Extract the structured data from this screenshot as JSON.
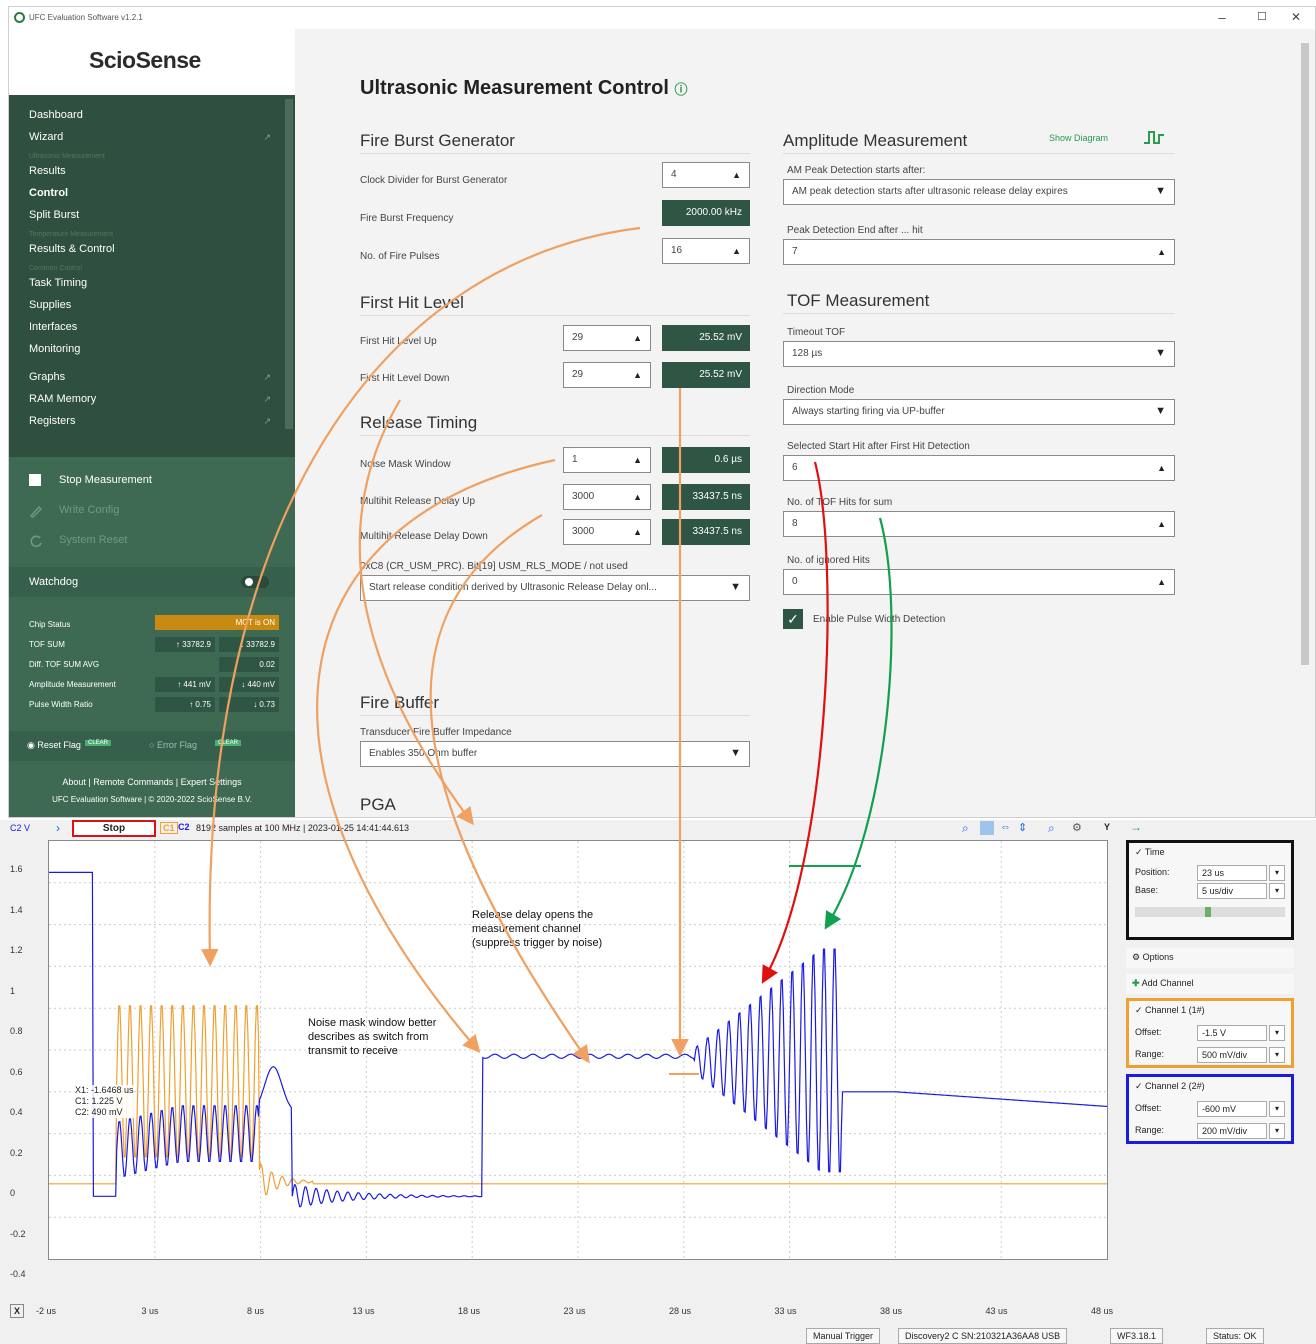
{
  "window": {
    "title": "UFC Evaluation Software v1.2.1",
    "controls": [
      "–",
      "☐",
      "✕"
    ]
  },
  "sidebar": {
    "logo": "ScioSense",
    "nav": [
      {
        "label": "Dashboard",
        "bold": false,
        "ext": false
      },
      {
        "label": "Wizard",
        "bold": false,
        "ext": true
      },
      {
        "section": "Ultrasonic Measurement"
      },
      {
        "label": "Results",
        "bold": false,
        "ext": false
      },
      {
        "label": "Control",
        "bold": true,
        "ext": false
      },
      {
        "label": "Split Burst",
        "bold": false,
        "ext": false
      },
      {
        "section": "Temperature Measurement"
      },
      {
        "label": "Results & Control",
        "bold": false,
        "ext": false
      },
      {
        "section": "Common Control"
      },
      {
        "label": "Task Timing",
        "bold": false,
        "ext": false
      },
      {
        "label": "Supplies",
        "bold": false,
        "ext": false
      },
      {
        "label": "Interfaces",
        "bold": false,
        "ext": false
      },
      {
        "label": "Monitoring",
        "bold": false,
        "ext": false
      },
      {
        "label": "Graphs",
        "bold": false,
        "ext": true
      },
      {
        "label": "RAM Memory",
        "bold": false,
        "ext": true
      },
      {
        "label": "Registers",
        "bold": false,
        "ext": true
      }
    ],
    "actions": {
      "stop": "Stop Measurement",
      "write": "Write Config",
      "reset": "System Reset"
    },
    "watchdog": "Watchdog",
    "status": {
      "chip_status_label": "Chip Status",
      "chip_status_value": "MCT is ON",
      "tof_sum_label": "TOF SUM",
      "tof_sum_up": "33782.9",
      "tof_sum_down": "33782.9",
      "diff_label": "Diff. TOF SUM AVG",
      "diff_value": "0.02",
      "amp_label": "Amplitude Measurement",
      "amp_up": "441 mV",
      "amp_down": "440 mV",
      "pwr_label": "Pulse Width Ratio",
      "pwr_up": "0.75",
      "pwr_down": "0.73"
    },
    "flags": {
      "reset": "Reset Flag",
      "error": "Error Flag",
      "clear": "CLEAR"
    },
    "footer": {
      "links": "About | Remote Commands | Expert Settings",
      "copyright": "UFC Evaluation Software | © 2020-2022 ScioSense B.V."
    }
  },
  "main": {
    "title": "Ultrasonic Measurement Control",
    "fire_burst": {
      "heading": "Fire Burst Generator",
      "clock_label": "Clock Divider for Burst Generator",
      "clock_value": "4",
      "freq_label": "Fire Burst Frequency",
      "freq_value": "2000.00 kHz",
      "pulses_label": "No. of Fire Pulses",
      "pulses_value": "16"
    },
    "first_hit": {
      "heading": "First Hit Level",
      "up_label": "First Hit Level Up",
      "up_value": "29",
      "up_mv": "25.52 mV",
      "down_label": "First Hit Level Down",
      "down_value": "29",
      "down_mv": "25.52 mV"
    },
    "release": {
      "heading": "Release Timing",
      "noise_label": "Noise Mask Window",
      "noise_value": "1",
      "noise_us": "0.6 µs",
      "up_label": "Multihit Release Delay Up",
      "up_value": "3000",
      "up_ns": "33437.5 ns",
      "down_label": "Multihit Release Delay Down",
      "down_value": "3000",
      "down_ns": "33437.5 ns",
      "mode_label": "0xC8 (CR_USM_PRC). Bit[19] USM_RLS_MODE / not used",
      "mode_value": "Start release condition derived by Ultrasonic Release Delay onl..."
    },
    "fire_buffer": {
      "heading": "Fire Buffer",
      "label": "Transducer Fire Buffer Impedance",
      "value": "Enables 350 Ohm buffer"
    },
    "pga_heading": "PGA",
    "amplitude": {
      "heading": "Amplitude Measurement",
      "show_diagram": "Show Diagram",
      "peak_start_label": "AM Peak Detection starts after:",
      "peak_start_value": "AM peak detection starts after ultrasonic release delay expires",
      "peak_end_label": "Peak Detection End after ... hit",
      "peak_end_value": "7"
    },
    "tof": {
      "heading": "TOF Measurement",
      "timeout_label": "Timeout TOF",
      "timeout_value": "128 µs",
      "direction_label": "Direction Mode",
      "direction_value": "Always starting firing via UP-buffer",
      "start_hit_label": "Selected Start Hit after First Hit Detection",
      "start_hit_value": "6",
      "hits_sum_label": "No. of TOF Hits for sum",
      "hits_sum_value": "8",
      "ignored_label": "No. of ignored Hits",
      "ignored_value": "0",
      "pulse_width_label": "Enable Pulse Width Detection"
    }
  },
  "scope": {
    "ch_label": "C2 V",
    "stop": "Stop",
    "c1": "C1",
    "c2": "C2",
    "info": "8192 samples at 100 MHz | 2023-01-25 14:41:44.613",
    "y_ticks": [
      "1.6",
      "1.4",
      "1.2",
      "1",
      "0.8",
      "0.6",
      "0.4",
      "0.2",
      "0",
      "-0.2",
      "-0.4"
    ],
    "x_ticks": [
      "-2 us",
      "3 us",
      "8 us",
      "13 us",
      "18 us",
      "23 us",
      "28 us",
      "33 us",
      "38 us",
      "43 us",
      "48 us"
    ],
    "cursor": {
      "x": "X1: -1.6468 us",
      "c1": "C1: 1.225 V",
      "c2": "C2: 490 mV"
    },
    "time": {
      "label": "Time",
      "position_label": "Position:",
      "position": "23 us",
      "base_label": "Base:",
      "base": "5 us/div"
    },
    "options": "Options",
    "add_channel": "Add Channel",
    "ch1": {
      "label": "Channel 1 (1#)",
      "offset_label": "Offset:",
      "offset": "-1.5 V",
      "range_label": "Range:",
      "range": "500 mV/div"
    },
    "ch2": {
      "label": "Channel 2 (2#)",
      "offset_label": "Offset:",
      "offset": "-600 mV",
      "range_label": "Range:",
      "range": "200 mV/div"
    },
    "footer": {
      "trigger": "Manual Trigger",
      "device": "Discovery2 C SN:210321A36AA8 USB",
      "wf": "WF3.18.1",
      "status": "Status: OK"
    },
    "x_axis_label": "X",
    "y_axis_label": "Y"
  },
  "annotations": {
    "noise": "Noise mask window better describes as switch from transmit to receive",
    "release": "Release delay opens the measurement channel (suppress trigger by noise)"
  },
  "colors": {
    "sidebar": "#2f4f3f",
    "accent": "#2a7b3f",
    "ch1": "#f0a030",
    "ch2": "#1a1ae6",
    "arrow_orange": "#f0a060",
    "arrow_red": "#e01010",
    "arrow_green": "#10a050"
  }
}
